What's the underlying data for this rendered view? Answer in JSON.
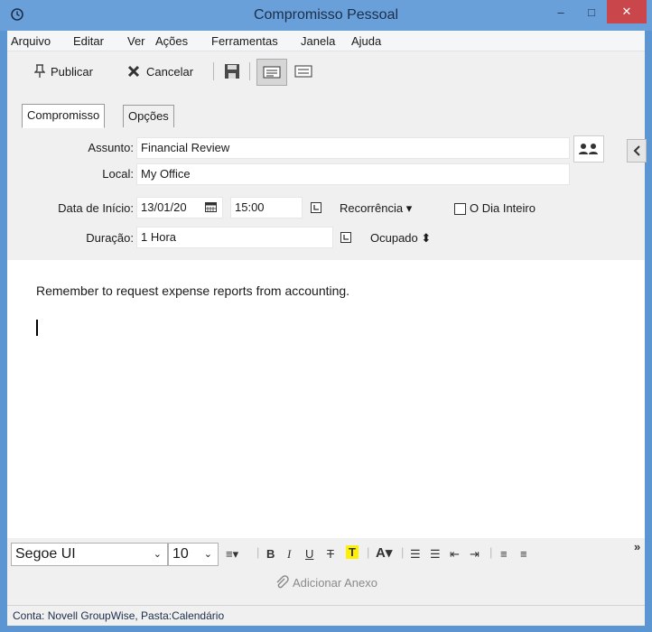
{
  "window": {
    "title": "Compromisso Pessoal",
    "minimize": "–",
    "maximize": "□",
    "close": "✕"
  },
  "menu": [
    "Arquivo",
    "Editar",
    "Ver",
    "Ações",
    "Ferramentas",
    "Janela",
    "Ajuda"
  ],
  "toolbar": {
    "publish_label": "Publicar",
    "cancel_label": "Cancelar"
  },
  "tabs": [
    "Compromisso",
    "Opções"
  ],
  "form": {
    "subject_label": "Assunto:",
    "subject_value": "Financial Review",
    "location_label": "Local:",
    "location_value": "My Office",
    "start_label": "Data de Início:",
    "start_date": "13/01/20",
    "start_time": "15:00",
    "recurrence_label": "Recorrência ▾",
    "all_day_label": "O Dia Inteiro",
    "all_day_checked": false,
    "duration_label": "Duração:",
    "duration_value": "1 Hora",
    "busy_label": "Ocupado ⬍"
  },
  "body": {
    "message": "Remember to request expense reports from accounting."
  },
  "format": {
    "font_name": "Segoe UI",
    "font_size": "10"
  },
  "attach": {
    "label": "Adicionar Anexo"
  },
  "status": {
    "text": "Conta: Novell GroupWise,  Pasta:Calendário"
  },
  "colors": {
    "title_bar": "#6aa0da",
    "close_button": "#c9474a",
    "highlight": "#ffef00"
  }
}
